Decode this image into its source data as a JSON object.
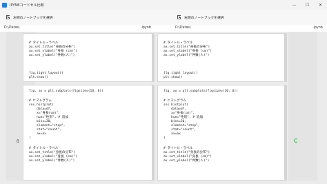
{
  "window": {
    "title": "IPYNBコードセル比較",
    "controls": {
      "minimize": "—",
      "maximize": "☐",
      "close": "✕"
    }
  },
  "toolbar": {
    "left_button": "左側のノートブックを選択",
    "right_button": "右側のノートブックを選択"
  },
  "paths": {
    "left_dir": "D:\\Datas\\",
    "left_ext": ".ipynb",
    "right_dir": "D:\\Datas\\",
    "right_ext": ".ipynb"
  },
  "gutter": {
    "left_icon": "brush-icon",
    "right_icon": "refresh-icon",
    "left_symbol": "ß"
  },
  "left": {
    "top_cell": [
      "# タイトル・ラベル",
      "ax.set_title(\"身長の分布\")",
      "ax.set_xlabel(\"身長 (cm)\")",
      "ax.set_ylabel(\"件数(人)\")",
      "",
      "",
      "fig.tight_layout()",
      "plt.show()"
    ],
    "bottom_cell": [
      "fig, ax = plt.subplots(figsize=(10, 6))",
      "",
      "# ヒストグラム",
      "sns.histplot(",
      "    data=df,",
      "    x=\"身長(cm)\",",
      "    hue=\"性別\", # 追加",
      "    bins=30,",
      "    element=\"step\",",
      "    stat=\"count\",",
      "    ax=ax",
      ")",
      "",
      "# タイトル・ラベル",
      "ax.set_title(\"身長の分布\")",
      "ax.set_xlabel(\"身長 (cm)\")",
      "ax.set_ylabel(\"件数(人)\")"
    ]
  },
  "right": {
    "top_cell": [
      "# タイトル・ラベル",
      "ax.set_title(\"身長の分布\")",
      "ax.set_xlabel(\"身長 (cm)\")",
      "ax.set_ylabel(\"件数(人)\")",
      "",
      "",
      "fig.tight_layout()",
      "plt.show()"
    ],
    "bottom_cell": [
      "fig, ax = plt.subplots(figsize=(10, 6))",
      "",
      "# ヒストグラム",
      "sns.histplot(",
      "    data=df,",
      "    x=\"身長(cm)\",",
      "    hue=\"性別\", # 追加",
      "    bins=30,",
      "    element=\"step\",",
      "    stat=\"count\",",
      "    ax=ax",
      ")",
      "",
      "# タイトル・ラベル",
      "ax.set_title(\"身長の分布\")",
      "ax.set_xlabel(\"身長 (cm)\")",
      "ax.set_ylabel(\"件数(人)\")"
    ]
  }
}
